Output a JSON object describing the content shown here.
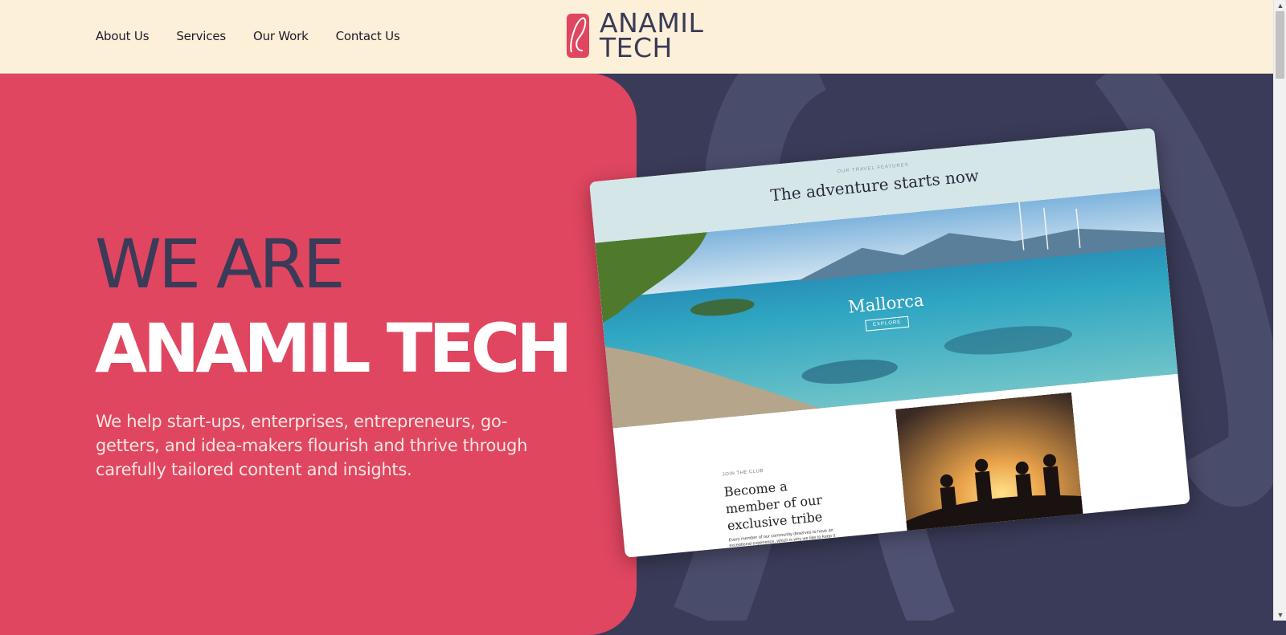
{
  "nav": {
    "links": [
      "About Us",
      "Services",
      "Our Work",
      "Contact Us"
    ],
    "logo_line1": "ANAMIL",
    "logo_line2": "TECH"
  },
  "hero": {
    "title_line1": "WE ARE",
    "title_line2": "ANAMIL TECH",
    "description": "We help start-ups, enterprises, entrepreneurs, go-getters, and idea-makers flourish and thrive through carefully tailored content and insights."
  },
  "mockup": {
    "eyebrow": "OUR TRAVEL FEATURES",
    "heading": "The adventure starts now",
    "place": "Mallorca",
    "button": "EXPLORE",
    "club_eyebrow": "JOIN THE CLUB",
    "club_heading": "Become a member of our exclusive tribe",
    "club_text": "Every member of our community deserves to have an exceptional experience, which is why we like to keep it exclusive. RCC membership – which includes our flagship bespoke concierge service – is therefore on a strict referral-only basis. Click"
  },
  "colors": {
    "navbar": "#fdf0d8",
    "hero_red": "#e04660",
    "navy": "#3a3b58",
    "white": "#ffffff"
  },
  "icons": [
    "logo-icon",
    "scroll-up-arrow-icon",
    "scroll-down-arrow-icon"
  ]
}
